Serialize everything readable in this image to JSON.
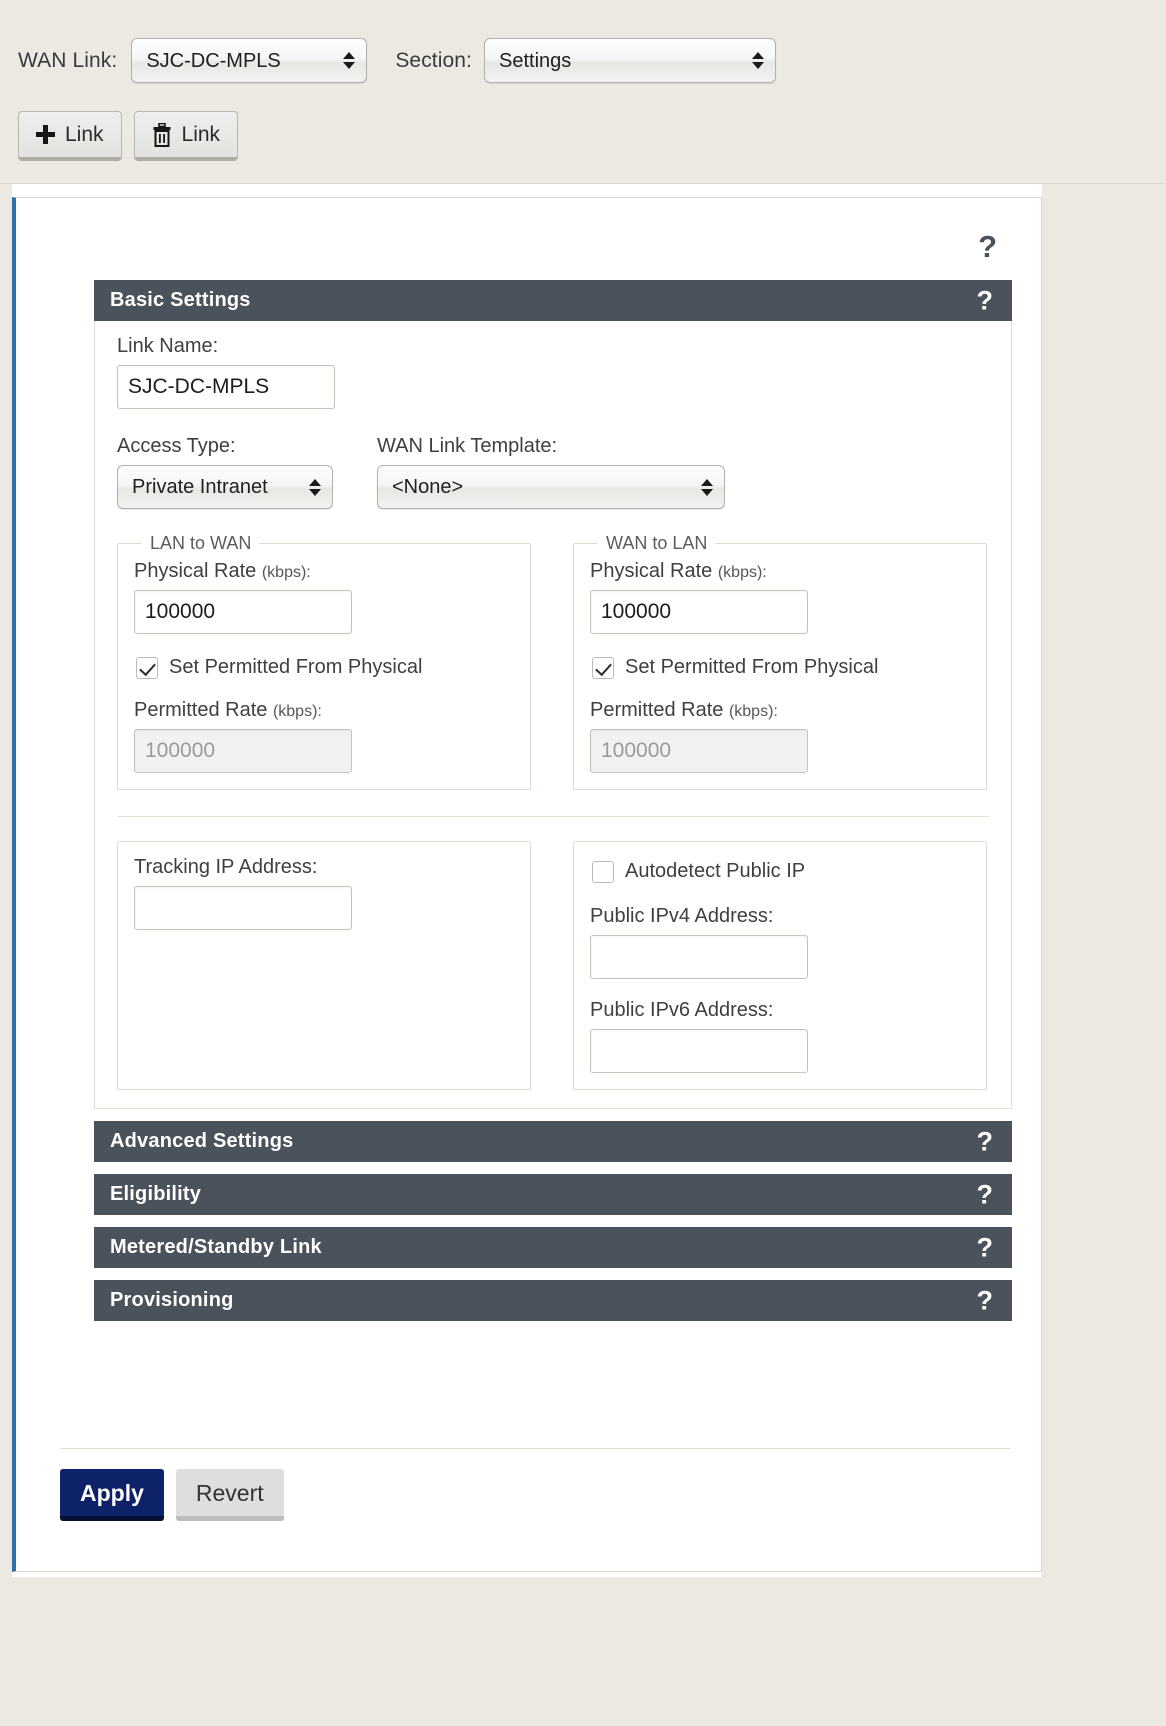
{
  "toolbar": {
    "wan_link_label": "WAN Link:",
    "wan_link_value": "SJC-DC-MPLS",
    "section_label": "Section:",
    "section_value": "Settings",
    "add_link_label": "Link",
    "delete_link_label": "Link"
  },
  "page": {
    "help_icon": "?"
  },
  "basic_settings": {
    "title": "Basic Settings",
    "help_icon": "?",
    "link_name_label": "Link Name:",
    "link_name_value": "SJC-DC-MPLS",
    "access_type_label": "Access Type:",
    "access_type_value": "Private Intranet",
    "wan_link_template_label": "WAN Link Template:",
    "wan_link_template_value": "<None>",
    "lan_to_wan": {
      "legend": "LAN to WAN",
      "physical_rate_label": "Physical Rate",
      "physical_rate_unit": "(kbps):",
      "physical_rate_value": "100000",
      "set_permitted_label": "Set Permitted From Physical",
      "set_permitted_checked": true,
      "permitted_rate_label": "Permitted Rate",
      "permitted_rate_unit": "(kbps):",
      "permitted_rate_value": "100000",
      "permitted_rate_disabled": true
    },
    "wan_to_lan": {
      "legend": "WAN to LAN",
      "physical_rate_label": "Physical Rate",
      "physical_rate_unit": "(kbps):",
      "physical_rate_value": "100000",
      "set_permitted_label": "Set Permitted From Physical",
      "set_permitted_checked": true,
      "permitted_rate_label": "Permitted Rate",
      "permitted_rate_unit": "(kbps):",
      "permitted_rate_value": "100000",
      "permitted_rate_disabled": true
    },
    "tracking": {
      "tracking_ip_label": "Tracking IP Address:",
      "tracking_ip_value": ""
    },
    "public_ip": {
      "autodetect_label": "Autodetect Public IP",
      "autodetect_checked": false,
      "ipv4_label": "Public IPv4 Address:",
      "ipv4_value": "",
      "ipv6_label": "Public IPv6 Address:",
      "ipv6_value": ""
    }
  },
  "sections": [
    {
      "title": "Advanced Settings",
      "help_icon": "?"
    },
    {
      "title": "Eligibility",
      "help_icon": "?"
    },
    {
      "title": "Metered/Standby Link",
      "help_icon": "?"
    },
    {
      "title": "Provisioning",
      "help_icon": "?"
    }
  ],
  "actions": {
    "apply_label": "Apply",
    "revert_label": "Revert"
  },
  "colors": {
    "section_header": "#4a525c",
    "apply_button": "#0d2268",
    "accent_rail": "#2f6fa8",
    "chrome": "#ece9e3"
  }
}
